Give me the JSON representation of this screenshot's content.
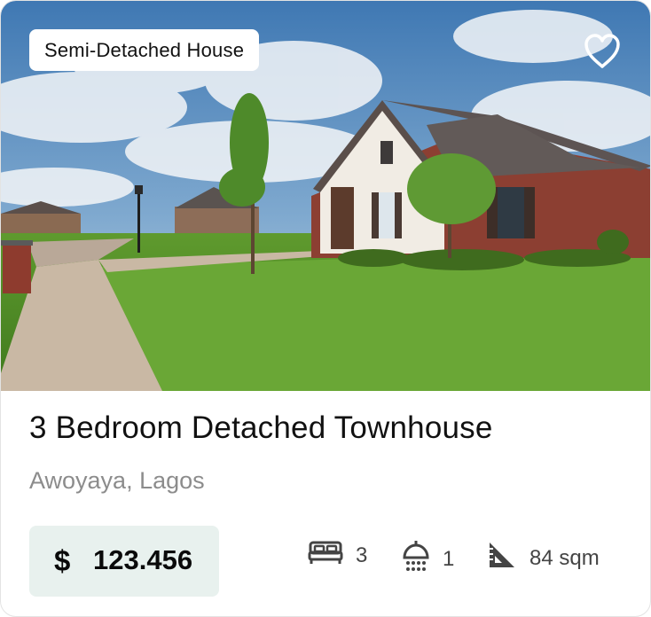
{
  "listing": {
    "type_badge": "Semi-Detached House",
    "title": "3 Bedroom Detached Townhouse",
    "location": "Awoyaya, Lagos",
    "price": {
      "currency": "$",
      "amount": "123.456"
    },
    "features": {
      "bedrooms": "3",
      "bathrooms": "1",
      "area": "84 sqm"
    },
    "icons": {
      "favorite": "heart-icon",
      "bedrooms": "bed-icon",
      "bathrooms": "shower-icon",
      "area": "set-square-icon"
    }
  },
  "colors": {
    "price_background": "#e8f1ee",
    "icon": "#444444",
    "location_text": "#8c8c8c"
  }
}
